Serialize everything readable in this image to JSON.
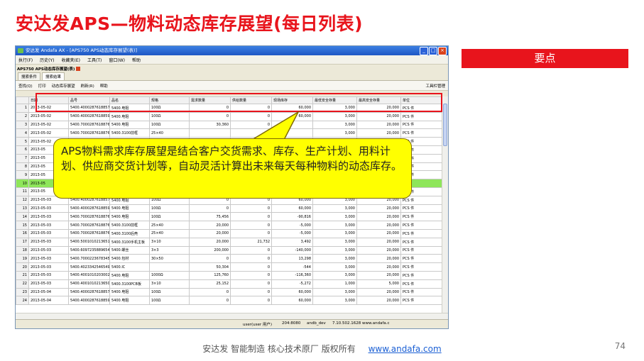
{
  "slide": {
    "title": "安达发APS—物料动态库存展望(每日列表)",
    "keypoint_label": "要点",
    "callout_text": "APS物料需求库存展望是结合客户交货需求、库存、生产计划、用料计划、供应商交货计划等，自动灵活计算出未来每天每种物料的动态库存。",
    "footer_text": "安达发   智能制造 核心技术原厂    版权所有",
    "footer_link": "www.andafa.com",
    "page_number": "74"
  },
  "app": {
    "window_title": "安达发 Andafa AX - [APS750 APS动态库存展望(表)]",
    "menu": [
      "执行(F)",
      "历史(Y)",
      "收藏夹(E)",
      "工具(T)",
      "窗口(W)",
      "帮助"
    ],
    "doc_tab": "APS750 APS动态库存展望(表)",
    "sub_tabs": [
      "搜索条件",
      "搜索结果"
    ],
    "toolbar": {
      "search": "查找(Q)",
      "print": "打印",
      "dynamic": "动态库存展望",
      "refresh": "刷新(R)",
      "help": "帮助",
      "column_manager": "工具栏管理"
    },
    "columns": [
      "",
      "日期",
      "品号",
      "品名",
      "规格",
      "需求数量",
      "供给数量",
      "现场库存",
      "最低安全存量",
      "最高安全存量",
      "单位"
    ],
    "rows": [
      [
        "1",
        "2013-05-02",
        "5400.4000287618857",
        "5400.电阻",
        "100Ω",
        "0",
        "0",
        "60,000",
        "3,000",
        "20,000",
        "PCS 件"
      ],
      [
        "2",
        "2013-05-02",
        "5400.4000287618859",
        "5400.电阻",
        "100Ω",
        "0",
        "0",
        "60,000",
        "3,000",
        "20,000",
        "PCS 件"
      ],
      [
        "3",
        "2013-05-02",
        "5400.7000287618876",
        "5400.电阻",
        "100Ω",
        "30,360",
        "0",
        "",
        "3,000",
        "20,000",
        "PCS 件"
      ],
      [
        "4",
        "2013-05-02",
        "5400.7000287618876",
        "5400.3100前框",
        "25×40",
        "",
        "0",
        "",
        "3,000",
        "20,000",
        "PCS 件"
      ],
      [
        "5",
        "2013-05-02",
        "",
        "",
        "",
        "",
        "",
        "",
        "3,000",
        "20,000",
        "PCS 件"
      ],
      [
        "6",
        "2013-05",
        "",
        "",
        "",
        "",
        "",
        "",
        "",
        "20,000",
        "PCS 件"
      ],
      [
        "7",
        "2013-05",
        "",
        "",
        "",
        "",
        "",
        "",
        "",
        "20,000",
        "PCS 件"
      ],
      [
        "8",
        "2013-05",
        "",
        "",
        "",
        "",
        "",
        "",
        "",
        "20,000",
        "PCS 件"
      ],
      [
        "9",
        "2013-05",
        "",
        "",
        "",
        "",
        "",
        "",
        "",
        "20,000",
        "PCS 件"
      ],
      [
        "10",
        "2013-05",
        "",
        "",
        "",
        "",
        "",
        "",
        "",
        "",
        ""
      ],
      [
        "11",
        "2013-05",
        "",
        "",
        "",
        "",
        "",
        "",
        "",
        "20,000",
        "PCS 件"
      ],
      [
        "12",
        "2013-05-03",
        "5400.4000287618857",
        "5400.电阻",
        "100Ω",
        "0",
        "0",
        "60,000",
        "3,000",
        "20,000",
        "PCS 件"
      ],
      [
        "13",
        "2013-05-03",
        "5400.4000287618859",
        "5400.电阻",
        "100Ω",
        "0",
        "0",
        "60,000",
        "3,000",
        "20,000",
        "PCS 件"
      ],
      [
        "14",
        "2013-05-03",
        "5400.7000287618876",
        "5400.电阻",
        "100Ω",
        "75,456",
        "0",
        "-90,816",
        "3,000",
        "20,000",
        "PCS 件"
      ],
      [
        "15",
        "2013-05-03",
        "5400.7000287618876",
        "5400.3100前框",
        "25×40",
        "20,000",
        "0",
        "-5,000",
        "3,000",
        "20,000",
        "PCS 件"
      ],
      [
        "16",
        "2013-05-03",
        "5400.7000287618876",
        "5400.3100后壳",
        "25×40",
        "20,000",
        "0",
        "-5,000",
        "3,000",
        "20,000",
        "PCS 件"
      ],
      [
        "17",
        "2013-05-03",
        "5400.5001010213651",
        "5400.3100手机主板",
        "3×10",
        "20,000",
        "21,732",
        "3,492",
        "3,000",
        "20,000",
        "PCS 件"
      ],
      [
        "18",
        "2013-05-03",
        "5400.6097235889654",
        "5400.螺丝",
        "3×3",
        "200,000",
        "0",
        "-140,000",
        "3,000",
        "20,000",
        "PCS 件"
      ],
      [
        "19",
        "2013-05-03",
        "5400.7000223678345",
        "5400.包材",
        "30×50",
        "0",
        "0",
        "13,298",
        "3,000",
        "20,000",
        "PCS 件"
      ],
      [
        "20",
        "2013-05-03",
        "5400.4023342546549",
        "5400.IC",
        "",
        "50,304",
        "0",
        "-544",
        "3,000",
        "20,000",
        "PCS 件"
      ],
      [
        "21",
        "2013-05-03",
        "5400.4001010203002",
        "5400.电阻",
        "1000Ω",
        "125,760",
        "0",
        "-116,360",
        "3,000",
        "20,000",
        "PCS 件"
      ],
      [
        "22",
        "2013-05-03",
        "5400.4001010213650",
        "5400.3100PCB板",
        "3×10",
        "25,152",
        "0",
        "-5,272",
        "1,000",
        "5,000",
        "PCS 件"
      ],
      [
        "23",
        "2013-05-04",
        "5400.4000287618857",
        "5400.电阻",
        "100Ω",
        "0",
        "0",
        "60,000",
        "3,000",
        "20,000",
        "PCS 件"
      ],
      [
        "24",
        "2013-05-04",
        "5400.4000287618859",
        "5400.电阻",
        "100Ω",
        "0",
        "0",
        "60,000",
        "3,000",
        "20,000",
        "PCS 件"
      ]
    ],
    "status": {
      "user": "user(user 用户)",
      "ip": "204:8080",
      "db": "andb_dev",
      "server": "7.10.502.1628",
      "site": "www.andafa.c"
    }
  }
}
